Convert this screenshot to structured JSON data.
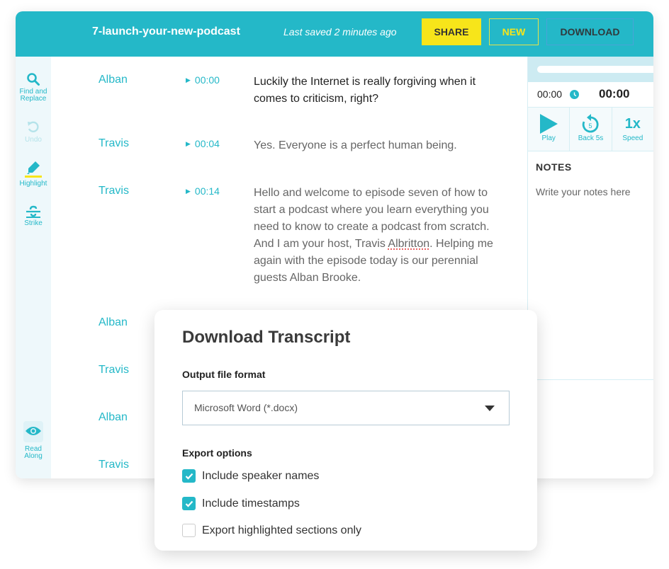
{
  "header": {
    "doc_title": "7-launch-your-new-podcast",
    "save_status": "Last saved 2 minutes ago",
    "share_label": "SHARE",
    "new_label": "NEW",
    "download_label": "DOWNLOAD"
  },
  "colors": {
    "brand": "#24b8c8",
    "accent_yellow": "#f7e51a"
  },
  "sidebar": {
    "tools": [
      {
        "label_line1": "Find and",
        "label_line2": "Replace",
        "icon": "search-icon",
        "enabled": true
      },
      {
        "label": "Undo",
        "icon": "undo-icon",
        "enabled": false
      },
      {
        "label": "Highlight",
        "icon": "highlighter-icon",
        "enabled": true
      },
      {
        "label": "Strike",
        "icon": "strikethrough-icon",
        "enabled": true
      },
      {
        "label_line1": "Read",
        "label_line2": "Along",
        "icon": "eye-icon",
        "enabled": true
      }
    ]
  },
  "transcript": {
    "entries": [
      {
        "speaker": "Alban",
        "timestamp": "00:00",
        "text": "Luckily the Internet is really forgiving when it comes to criticism, right?"
      },
      {
        "speaker": "Travis",
        "timestamp": "00:04",
        "text": "Yes. Everyone is a perfect human being."
      },
      {
        "speaker": "Travis",
        "timestamp": "00:14",
        "text_before": "Hello and welcome to episode seven of how to start a podcast where you learn everything you need to know to create a podcast from scratch. And I am your host, Travis ",
        "text_misspelled": "Albritton",
        "text_after": ". Helping me again with the episode today is our perennial guests Alban Brooke."
      },
      {
        "speaker": "Alban"
      },
      {
        "speaker": "Travis"
      },
      {
        "speaker": "Alban"
      },
      {
        "speaker": "Travis"
      }
    ]
  },
  "player": {
    "progress": 0,
    "current_time": "00:00",
    "total_time": "00:00",
    "play_label": "Play",
    "back_label": "Back 5s",
    "back_seconds": "5",
    "speed_value": "1x",
    "speed_label": "Speed"
  },
  "notes": {
    "title": "NOTES",
    "placeholder": "Write your notes here"
  },
  "modal": {
    "title": "Download Transcript",
    "format_label": "Output file format",
    "format_value": "Microsoft Word (*.docx)",
    "options_label": "Export options",
    "options": [
      {
        "label": "Include speaker names",
        "checked": true
      },
      {
        "label": "Include timestamps",
        "checked": true
      },
      {
        "label": "Export highlighted sections only",
        "checked": false
      }
    ]
  }
}
